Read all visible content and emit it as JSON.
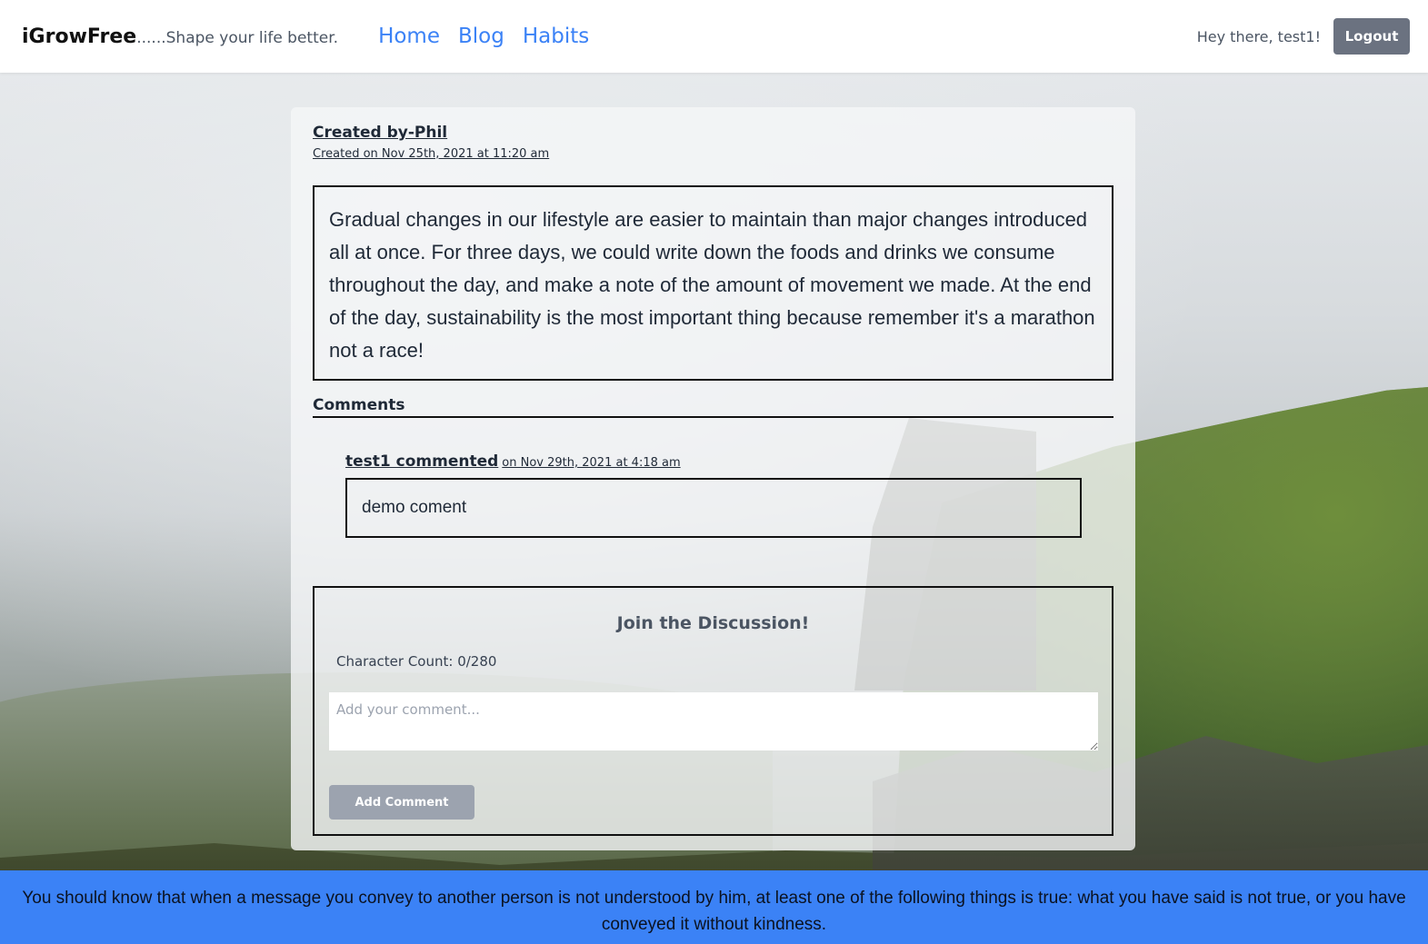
{
  "nav": {
    "brand_name": "iGrowFree",
    "brand_tagline": "......Shape your life better.",
    "links": [
      "Home",
      "Blog",
      "Habits"
    ],
    "greeting": "Hey there, test1!",
    "logout_label": "Logout"
  },
  "post": {
    "author": "Created by-Phil",
    "created": "Created on Nov 25th, 2021 at 11:20 am",
    "body": "Gradual changes in our lifestyle are easier to maintain than major changes introduced all at once. For three days, we could write down the foods and drinks we consume throughout the day, and make a note of the amount of movement we made. At the end of the day, sustainability is the most important thing because remember it's a marathon not a race!"
  },
  "comments": {
    "title": "Comments",
    "items": [
      {
        "user": "test1 commented",
        "date": "on Nov 29th, 2021 at 4:18 am",
        "text": "demo coment"
      }
    ]
  },
  "discussion": {
    "title": "Join the Discussion!",
    "char_count": "Character Count: 0/280",
    "placeholder": "Add your comment...",
    "button_label": "Add Comment"
  },
  "footer": {
    "quote": "You should know that when a message you convey to another person is not understood by him, at least one of the following things is true: what you have said is not true, or you have conveyed it without kindness."
  },
  "colors": {
    "accent": "#3b82f6",
    "logout_bg": "#6b7280",
    "add_button_bg": "#9ca3af"
  }
}
